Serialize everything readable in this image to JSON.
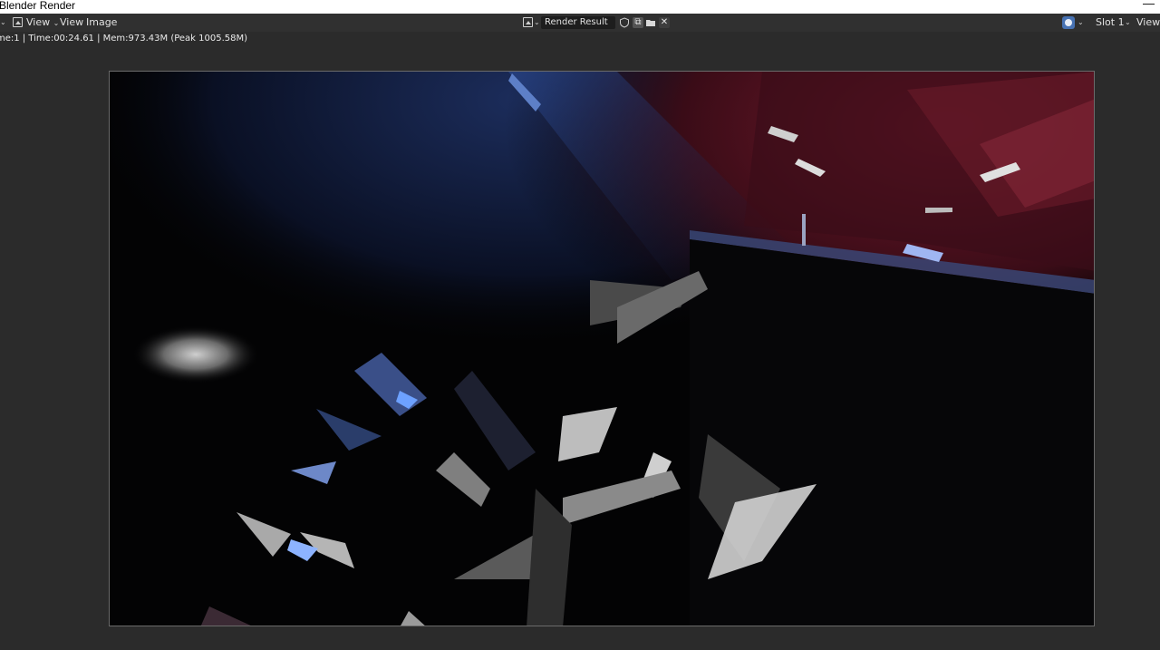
{
  "window": {
    "title": "Blender Render",
    "minimize_glyph": "—"
  },
  "header": {
    "editor_type_icon": "image-editor-icon",
    "menu_view_dropdown": "View",
    "menu_view": "View",
    "menu_image": "Image",
    "image_name": "Render Result",
    "image_buttons": [
      "shield-icon",
      "duplicate-icon",
      "open-folder-icon",
      "close-icon"
    ],
    "slot": "Slot 1",
    "view_layer": "ViewLa",
    "display_icon": "display-channels-icon",
    "accent_color": "#4772b3"
  },
  "stats": {
    "text": "me:1 | Time:00:24.61 | Mem:973.43M (Peak 1005.58M)"
  },
  "colors": {
    "background": "#2b2b2b",
    "header": "#303030",
    "field": "#1d1d1d"
  }
}
